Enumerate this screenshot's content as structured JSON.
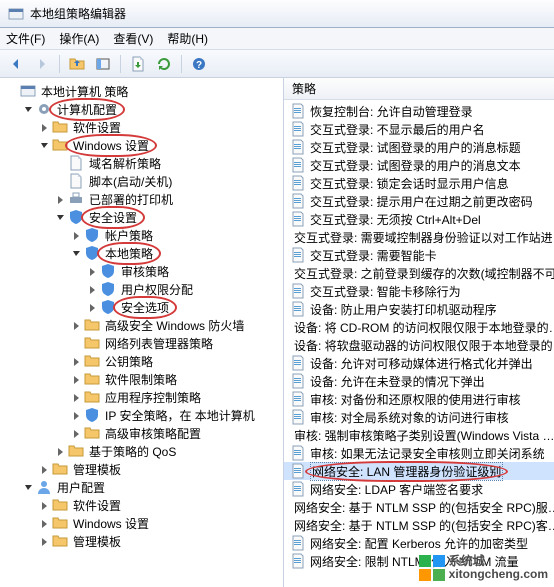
{
  "window": {
    "title": "本地组策略编辑器"
  },
  "menu": {
    "file": "文件(F)",
    "action": "操作(A)",
    "view": "查看(V)",
    "help": "帮助(H)"
  },
  "toolbar_icons": [
    "back",
    "forward",
    "up",
    "show-hide",
    "export",
    "refresh",
    "help"
  ],
  "list_header": "策略",
  "tree": [
    {
      "depth": 0,
      "expand": "none",
      "icon": "root",
      "label": "本地计算机 策略",
      "circled": false
    },
    {
      "depth": 1,
      "expand": "open",
      "icon": "gear",
      "label": "计算机配置",
      "circled": true
    },
    {
      "depth": 2,
      "expand": "closed",
      "icon": "folder",
      "label": "软件设置",
      "circled": false
    },
    {
      "depth": 2,
      "expand": "open",
      "icon": "folder",
      "label": "Windows 设置",
      "circled": true
    },
    {
      "depth": 3,
      "expand": "none",
      "icon": "doc",
      "label": "域名解析策略",
      "circled": false
    },
    {
      "depth": 3,
      "expand": "none",
      "icon": "doc",
      "label": "脚本(启动/关机)",
      "circled": false
    },
    {
      "depth": 3,
      "expand": "closed",
      "icon": "printer",
      "label": "已部署的打印机",
      "circled": false
    },
    {
      "depth": 3,
      "expand": "open",
      "icon": "shield",
      "label": "安全设置",
      "circled": true
    },
    {
      "depth": 4,
      "expand": "closed",
      "icon": "shield",
      "label": "帐户策略",
      "circled": false
    },
    {
      "depth": 4,
      "expand": "open",
      "icon": "shield",
      "label": "本地策略",
      "circled": true
    },
    {
      "depth": 5,
      "expand": "closed",
      "icon": "shield",
      "label": "审核策略",
      "circled": false
    },
    {
      "depth": 5,
      "expand": "closed",
      "icon": "shield",
      "label": "用户权限分配",
      "circled": false
    },
    {
      "depth": 5,
      "expand": "closed",
      "icon": "shield",
      "label": "安全选项",
      "circled": true
    },
    {
      "depth": 4,
      "expand": "closed",
      "icon": "folder",
      "label": "高级安全 Windows 防火墙",
      "circled": false
    },
    {
      "depth": 4,
      "expand": "none",
      "icon": "folder",
      "label": "网络列表管理器策略",
      "circled": false
    },
    {
      "depth": 4,
      "expand": "closed",
      "icon": "folder",
      "label": "公钥策略",
      "circled": false
    },
    {
      "depth": 4,
      "expand": "closed",
      "icon": "folder",
      "label": "软件限制策略",
      "circled": false
    },
    {
      "depth": 4,
      "expand": "closed",
      "icon": "folder",
      "label": "应用程序控制策略",
      "circled": false
    },
    {
      "depth": 4,
      "expand": "closed",
      "icon": "shield",
      "label": "IP 安全策略，在 本地计算机",
      "circled": false
    },
    {
      "depth": 4,
      "expand": "closed",
      "icon": "folder",
      "label": "高级审核策略配置",
      "circled": false
    },
    {
      "depth": 3,
      "expand": "closed",
      "icon": "folder",
      "label": "基于策略的 QoS",
      "circled": false
    },
    {
      "depth": 2,
      "expand": "closed",
      "icon": "folder",
      "label": "管理模板",
      "circled": false
    },
    {
      "depth": 1,
      "expand": "open",
      "icon": "user",
      "label": "用户配置",
      "circled": false
    },
    {
      "depth": 2,
      "expand": "closed",
      "icon": "folder",
      "label": "软件设置",
      "circled": false
    },
    {
      "depth": 2,
      "expand": "closed",
      "icon": "folder",
      "label": "Windows 设置",
      "circled": false
    },
    {
      "depth": 2,
      "expand": "closed",
      "icon": "folder",
      "label": "管理模板",
      "circled": false
    }
  ],
  "policies": [
    {
      "label": "恢复控制台: 允许自动管理登录",
      "sel": false,
      "circled": false
    },
    {
      "label": "交互式登录: 不显示最后的用户名",
      "sel": false,
      "circled": false
    },
    {
      "label": "交互式登录: 试图登录的用户的消息标题",
      "sel": false,
      "circled": false
    },
    {
      "label": "交互式登录: 试图登录的用户的消息文本",
      "sel": false,
      "circled": false
    },
    {
      "label": "交互式登录: 锁定会话时显示用户信息",
      "sel": false,
      "circled": false
    },
    {
      "label": "交互式登录: 提示用户在过期之前更改密码",
      "sel": false,
      "circled": false
    },
    {
      "label": "交互式登录: 无须按 Ctrl+Alt+Del",
      "sel": false,
      "circled": false
    },
    {
      "label": "交互式登录: 需要域控制器身份验证以对工作站进…",
      "sel": false,
      "circled": false
    },
    {
      "label": "交互式登录: 需要智能卡",
      "sel": false,
      "circled": false
    },
    {
      "label": "交互式登录: 之前登录到缓存的次数(域控制器不可…",
      "sel": false,
      "circled": false
    },
    {
      "label": "交互式登录: 智能卡移除行为",
      "sel": false,
      "circled": false
    },
    {
      "label": "设备: 防止用户安装打印机驱动程序",
      "sel": false,
      "circled": false
    },
    {
      "label": "设备: 将 CD-ROM 的访问权限仅限于本地登录的…",
      "sel": false,
      "circled": false
    },
    {
      "label": "设备: 将软盘驱动器的访问权限仅限于本地登录的…",
      "sel": false,
      "circled": false
    },
    {
      "label": "设备: 允许对可移动媒体进行格式化并弹出",
      "sel": false,
      "circled": false
    },
    {
      "label": "设备: 允许在未登录的情况下弹出",
      "sel": false,
      "circled": false
    },
    {
      "label": "审核: 对备份和还原权限的使用进行审核",
      "sel": false,
      "circled": false
    },
    {
      "label": "审核: 对全局系统对象的访问进行审核",
      "sel": false,
      "circled": false
    },
    {
      "label": "审核: 强制审核策略子类别设置(Windows Vista …",
      "sel": false,
      "circled": false
    },
    {
      "label": "审核: 如果无法记录安全审核则立即关闭系统",
      "sel": false,
      "circled": false
    },
    {
      "label": "网络安全: LAN 管理器身份验证级别",
      "sel": true,
      "circled": true
    },
    {
      "label": "网络安全: LDAP 客户端签名要求",
      "sel": false,
      "circled": false
    },
    {
      "label": "网络安全: 基于 NTLM SSP 的(包括安全 RPC)服…",
      "sel": false,
      "circled": false
    },
    {
      "label": "网络安全: 基于 NTLM SSP 的(包括安全 RPC)客…",
      "sel": false,
      "circled": false
    },
    {
      "label": "网络安全: 配置 Kerberos 允许的加密类型",
      "sel": false,
      "circled": false
    },
    {
      "label": "网络安全: 限制 NTLM: 传入 NTLM 流量",
      "sel": false,
      "circled": false
    }
  ],
  "watermark": {
    "line1": "系统城",
    "line2": "xitongcheng.com"
  }
}
